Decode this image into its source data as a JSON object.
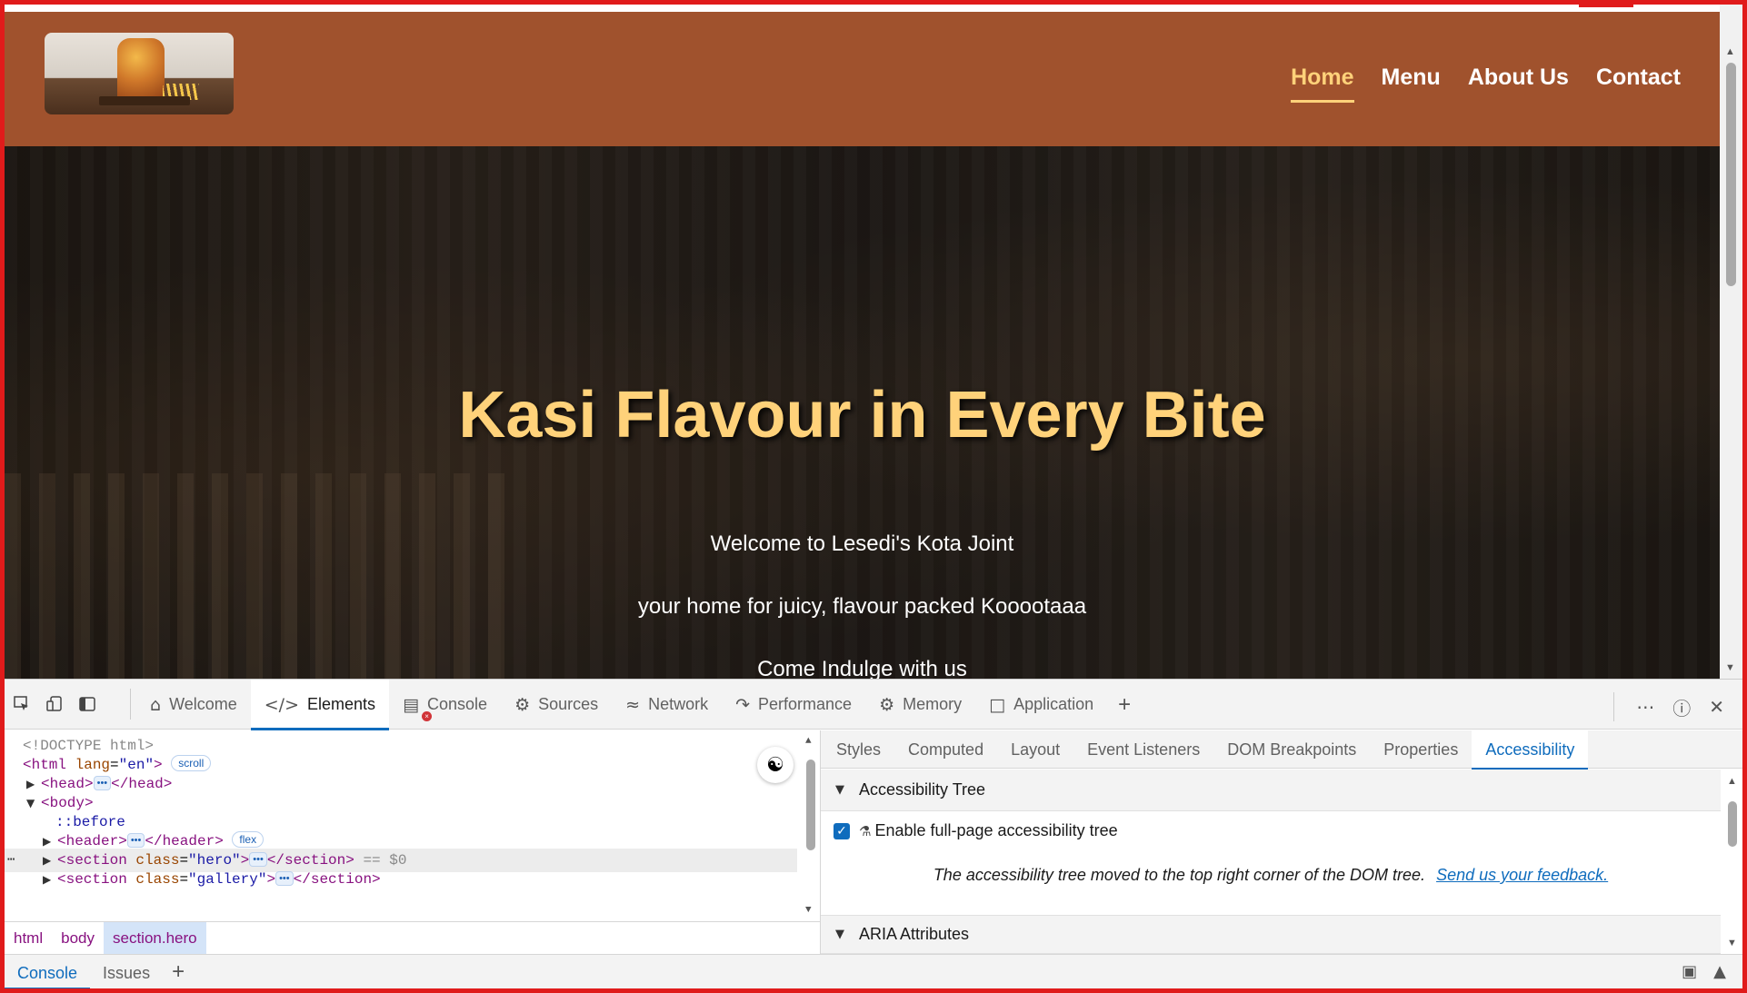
{
  "site": {
    "nav": [
      "Home",
      "Menu",
      "About Us",
      "Contact"
    ],
    "active_nav": "Home",
    "hero_title": "Kasi Flavour in Every Bite",
    "hero_lines": [
      "Welcome to Lesedi's Kota Joint",
      "your home for juicy, flavour packed Kooootaaa",
      "Come Indulge with us"
    ],
    "colors": {
      "header_bg": "#a0522d",
      "accent": "#ffd27a",
      "hero_text": "#ffffff"
    }
  },
  "devtools": {
    "tabs": [
      {
        "label": "Welcome",
        "icon": "home-icon"
      },
      {
        "label": "Elements",
        "icon": "code-icon"
      },
      {
        "label": "Console",
        "icon": "console-icon"
      },
      {
        "label": "Sources",
        "icon": "bug-icon"
      },
      {
        "label": "Network",
        "icon": "wifi-icon"
      },
      {
        "label": "Performance",
        "icon": "performance-icon"
      },
      {
        "label": "Memory",
        "icon": "memory-icon"
      },
      {
        "label": "Application",
        "icon": "application-icon"
      }
    ],
    "active_tab": "Elements",
    "dom": {
      "doctype": "<!DOCTYPE html>",
      "html_open": "<html",
      "html_attr": "lang",
      "html_val": "\"en\"",
      "html_close": ">",
      "scroll_badge": "scroll",
      "head_open": "<head>",
      "head_close": "</head>",
      "body_open": "<body>",
      "before": "::before",
      "header_open": "<header>",
      "header_close": "</header>",
      "flex_badge": "flex",
      "section_open": "<section",
      "class_attr": "class",
      "hero_val": "\"hero\"",
      "gallery_val": "\"gallery\"",
      "tag_close": ">",
      "section_close": "</section>",
      "ellipsis": "•••",
      "selected_marker": "== $0"
    },
    "breadcrumbs": [
      "html",
      "body",
      "section.hero"
    ],
    "sidebar_tabs": [
      "Styles",
      "Computed",
      "Layout",
      "Event Listeners",
      "DOM Breakpoints",
      "Properties",
      "Accessibility"
    ],
    "active_sidebar_tab": "Accessibility",
    "accessibility": {
      "tree_section": "Accessibility Tree",
      "enable_label": "Enable full-page accessibility tree",
      "enable_checked": true,
      "note": "The accessibility tree moved to the top right corner of the DOM tree.",
      "feedback_link": "Send us your feedback.",
      "aria_section": "ARIA Attributes"
    },
    "drawer_tabs": [
      "Console",
      "Issues"
    ],
    "active_drawer_tab": "Console"
  }
}
